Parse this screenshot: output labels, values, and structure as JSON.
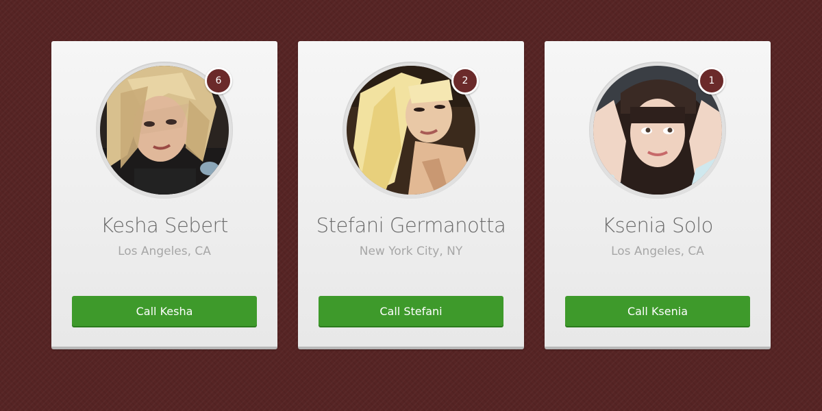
{
  "colors": {
    "background": "#562424",
    "card": "#f2f2f2",
    "badge": "#6b2a2a",
    "button": "#3e9a2b",
    "name_text": "#6a6a6a",
    "location_text": "#a6a6a6"
  },
  "cards": [
    {
      "name": "Kesha Sebert",
      "location": "Los Angeles, CA",
      "badge_count": "6",
      "button_label": "Call Kesha",
      "avatar_alt": "Kesha Sebert photo"
    },
    {
      "name": "Stefani Germanotta",
      "location": "New York City, NY",
      "badge_count": "2",
      "button_label": "Call Stefani",
      "avatar_alt": "Stefani Germanotta photo"
    },
    {
      "name": "Ksenia Solo",
      "location": "Los Angeles, CA",
      "badge_count": "1",
      "button_label": "Call Ksenia",
      "avatar_alt": "Ksenia Solo photo"
    }
  ]
}
